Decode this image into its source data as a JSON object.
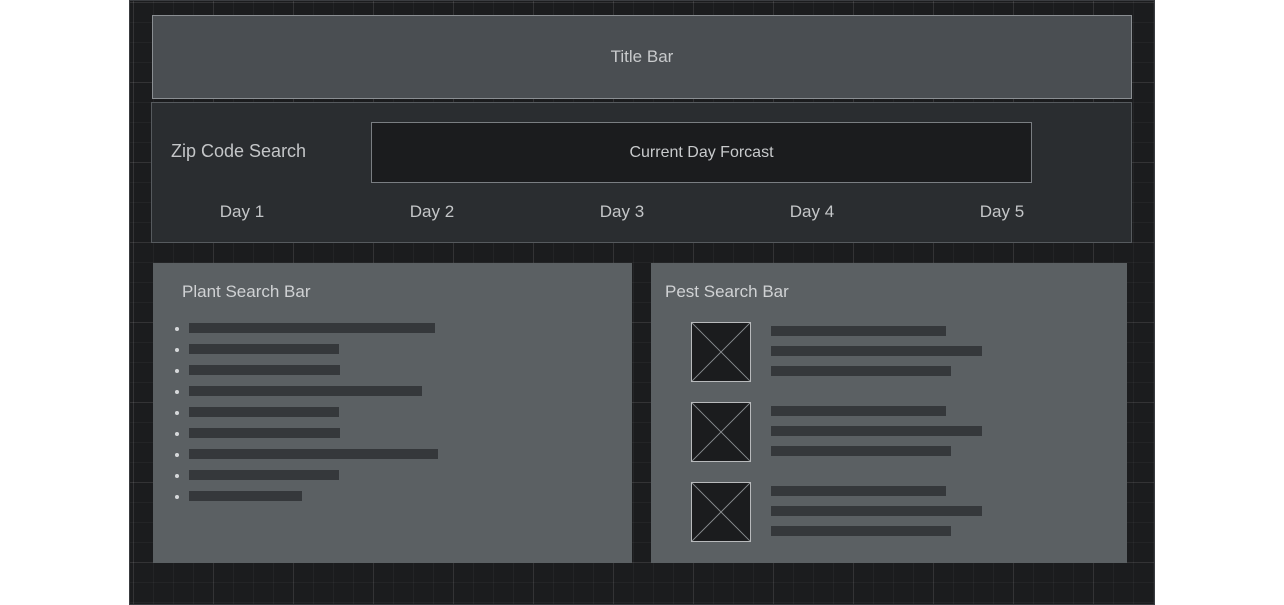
{
  "title_bar": {
    "label": "Title Bar"
  },
  "weather": {
    "zip_label": "Zip Code Search",
    "current_label": "Current Day Forcast",
    "days": [
      "Day 1",
      "Day 2",
      "Day 3",
      "Day 4",
      "Day 5"
    ]
  },
  "plant_panel": {
    "title": "Plant Search Bar",
    "item_count": 9
  },
  "pest_panel": {
    "title": "Pest Search Bar",
    "card_count": 3,
    "card_icon": "image-placeholder-icon"
  },
  "colors": {
    "canvas": "#1b1c1e",
    "title_bar": "#4a4e52",
    "weather_strip": "#2a2d30",
    "panel": "#5b6063",
    "placeholder_line": "#35383b"
  }
}
